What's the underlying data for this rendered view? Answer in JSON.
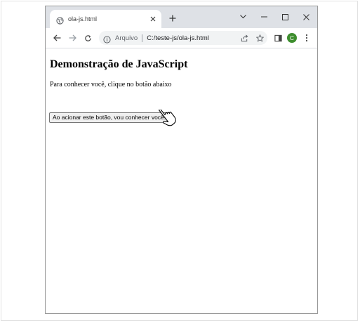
{
  "browser": {
    "tab": {
      "title": "ola-js.html",
      "favicon": "globe-icon"
    },
    "new_tab_icon": "plus-icon",
    "window_controls": [
      "chevron-down-icon",
      "minimize-icon",
      "maximize-icon",
      "close-icon"
    ],
    "toolbar": {
      "nav_icons": [
        "back-arrow-icon",
        "forward-arrow-icon",
        "reload-icon"
      ],
      "security_label": "Arquivo",
      "url": "C:/teste-js/ola-js.html",
      "omnibox_icons": [
        "share-icon",
        "star-icon"
      ],
      "right_icons": [
        "side-panel-icon",
        "profile-avatar",
        "menu-icon"
      ],
      "avatar_letter": "C",
      "avatar_color": "#3e8e2f"
    }
  },
  "page": {
    "heading": "Demonstração de JavaScript",
    "paragraph": "Para conhecer você, clique no botão abaixo",
    "button_label": "Ao acionar este botão, vou conhecer você!"
  },
  "colors": {
    "tabstrip_bg": "#dee1e6",
    "omnibox_bg": "#f1f3f4",
    "window_border": "#9a9a9a"
  }
}
